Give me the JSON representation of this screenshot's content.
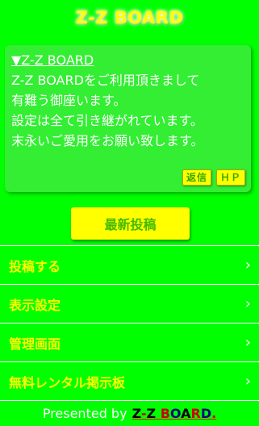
{
  "header": {
    "title": "Z-Z BOARD"
  },
  "notice": {
    "title": "▼Z-Z BOARD",
    "lines": [
      "Z-Z BOARDをご利用頂きまして",
      "有難う御座います。",
      "設定は全て引き継がれています。",
      "末永いご愛用をお願い致します。"
    ],
    "reply_label": "返信",
    "hp_label": "ＨＰ"
  },
  "latest_button": {
    "label": "最新投稿"
  },
  "menu": {
    "items": [
      {
        "label": "投稿する"
      },
      {
        "label": "表示設定"
      },
      {
        "label": "管理画面"
      },
      {
        "label": "無料レンタル掲示板"
      }
    ]
  },
  "footer": {
    "prefix": "Presented by",
    "brand_parts": [
      "Z",
      "-",
      "Z",
      " ",
      "B",
      "O",
      "A",
      "R",
      "D",
      "."
    ]
  },
  "colors": {
    "background": "#00ff00",
    "accent_yellow": "#ffff00",
    "panel": "#33ee33"
  },
  "icons": {
    "menu_chevron": "chevron-right-icon"
  }
}
